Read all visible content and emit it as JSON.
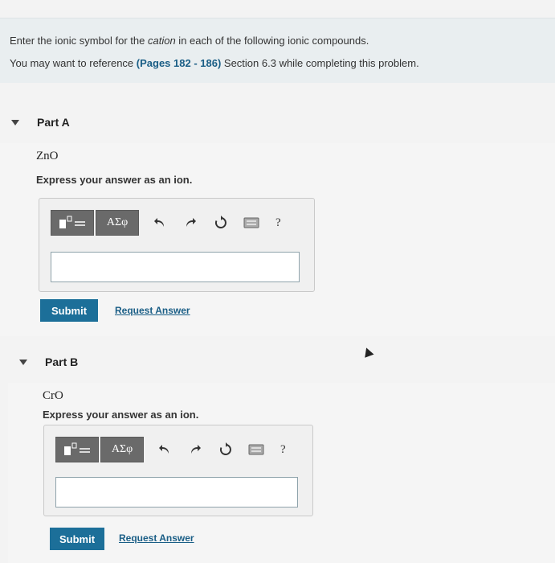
{
  "intro": {
    "line1_pre": "Enter the ionic symbol for the ",
    "line1_em": "cation",
    "line1_post": " in each of the following ionic compounds.",
    "line2_pre": "You may want to reference ",
    "line2_ref": "(Pages 182 - 186)",
    "line2_post": " Section 6.3 while completing this problem."
  },
  "parts": [
    {
      "title": "Part A",
      "compound": "ZnO",
      "instruction": "Express your answer as an ion.",
      "toolbar": {
        "greek_label": "ΑΣφ",
        "help_label": "?"
      },
      "answer_value": "",
      "submit_label": "Submit",
      "request_label": "Request Answer"
    },
    {
      "title": "Part B",
      "compound": "CrO",
      "instruction": "Express your answer as an ion.",
      "toolbar": {
        "greek_label": "ΑΣφ",
        "help_label": "?"
      },
      "answer_value": "",
      "submit_label": "Submit",
      "request_label": "Request Answer"
    }
  ],
  "icons": [
    "template-icon",
    "undo-icon",
    "redo-icon",
    "reset-icon",
    "keyboard-icon"
  ],
  "colors": {
    "accent": "#1c6f99",
    "link": "#1a5e86",
    "toolbar_button": "#6a6a6a"
  }
}
